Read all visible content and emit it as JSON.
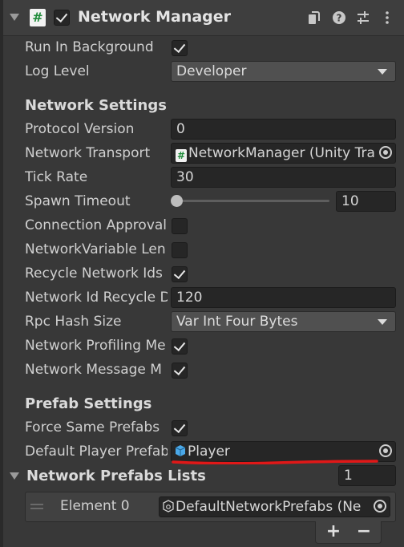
{
  "component": {
    "title": "Network Manager",
    "script_glyph": "#"
  },
  "fields": {
    "run_in_background": {
      "label": "Run In Background",
      "checked": true
    },
    "log_level": {
      "label": "Log Level",
      "value": "Developer"
    }
  },
  "network_settings": {
    "heading": "Network Settings",
    "protocol_version": {
      "label": "Protocol Version",
      "value": "0"
    },
    "network_transport": {
      "label": "Network Transport",
      "value": "NetworkManager (Unity Tra",
      "glyph": "#"
    },
    "tick_rate": {
      "label": "Tick Rate",
      "value": "30"
    },
    "spawn_timeout": {
      "label": "Spawn Timeout",
      "value": "10",
      "slider_fraction": 0.0
    },
    "connection_approval": {
      "label": "Connection Approval",
      "checked": false
    },
    "network_variable_len": {
      "label": "NetworkVariable Len",
      "checked": false
    },
    "recycle_network_ids": {
      "label": "Recycle Network Ids",
      "checked": true
    },
    "network_id_recycle": {
      "label": "Network Id Recycle D",
      "value": "120"
    },
    "rpc_hash_size": {
      "label": "Rpc Hash Size",
      "value": "Var Int Four Bytes"
    },
    "network_profiling": {
      "label": "Network Profiling Me",
      "checked": true
    },
    "network_message": {
      "label": "Network Message M",
      "checked": true
    }
  },
  "prefab_settings": {
    "heading": "Prefab Settings",
    "force_same_prefabs": {
      "label": "Force Same Prefabs",
      "checked": true
    },
    "default_player_prefab": {
      "label": "Default Player Prefab",
      "value": "Player"
    }
  },
  "network_prefabs_lists": {
    "heading": "Network Prefabs Lists",
    "count": "1",
    "elements": [
      {
        "label": "Element 0",
        "value": "DefaultNetworkPrefabs (Ne"
      }
    ],
    "add_label": "+",
    "remove_label": "−"
  },
  "colors": {
    "annotation_underline": "#e01818",
    "prefab_icon": "#4aa8e8"
  }
}
